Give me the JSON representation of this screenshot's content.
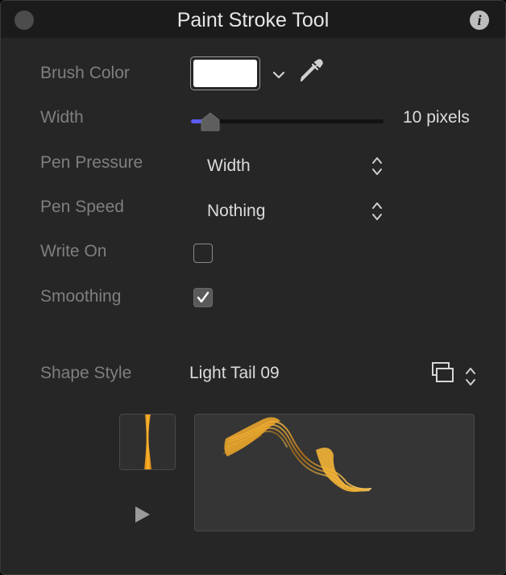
{
  "window": {
    "title": "Paint Stroke Tool"
  },
  "brush_color": {
    "label": "Brush Color",
    "color": "#ffffff"
  },
  "width": {
    "label": "Width",
    "value_text": "10 pixels",
    "slider_fraction": 0.1
  },
  "pen_pressure": {
    "label": "Pen Pressure",
    "value": "Width"
  },
  "pen_speed": {
    "label": "Pen Speed",
    "value": "Nothing"
  },
  "write_on": {
    "label": "Write On",
    "checked": false
  },
  "smoothing": {
    "label": "Smoothing",
    "checked": true
  },
  "shape_style": {
    "label": "Shape Style",
    "value": "Light Tail 09"
  },
  "colors": {
    "accent": "#5b5bf0",
    "stroke": "#f5a623",
    "panel": "#262626",
    "titlebar": "#1b1b1b"
  },
  "icons": [
    "close-dot-icon",
    "info-icon",
    "chevron-down-icon",
    "eyedropper-icon",
    "stepper-icon",
    "shape-library-icon",
    "play-icon",
    "checkmark-icon"
  ]
}
